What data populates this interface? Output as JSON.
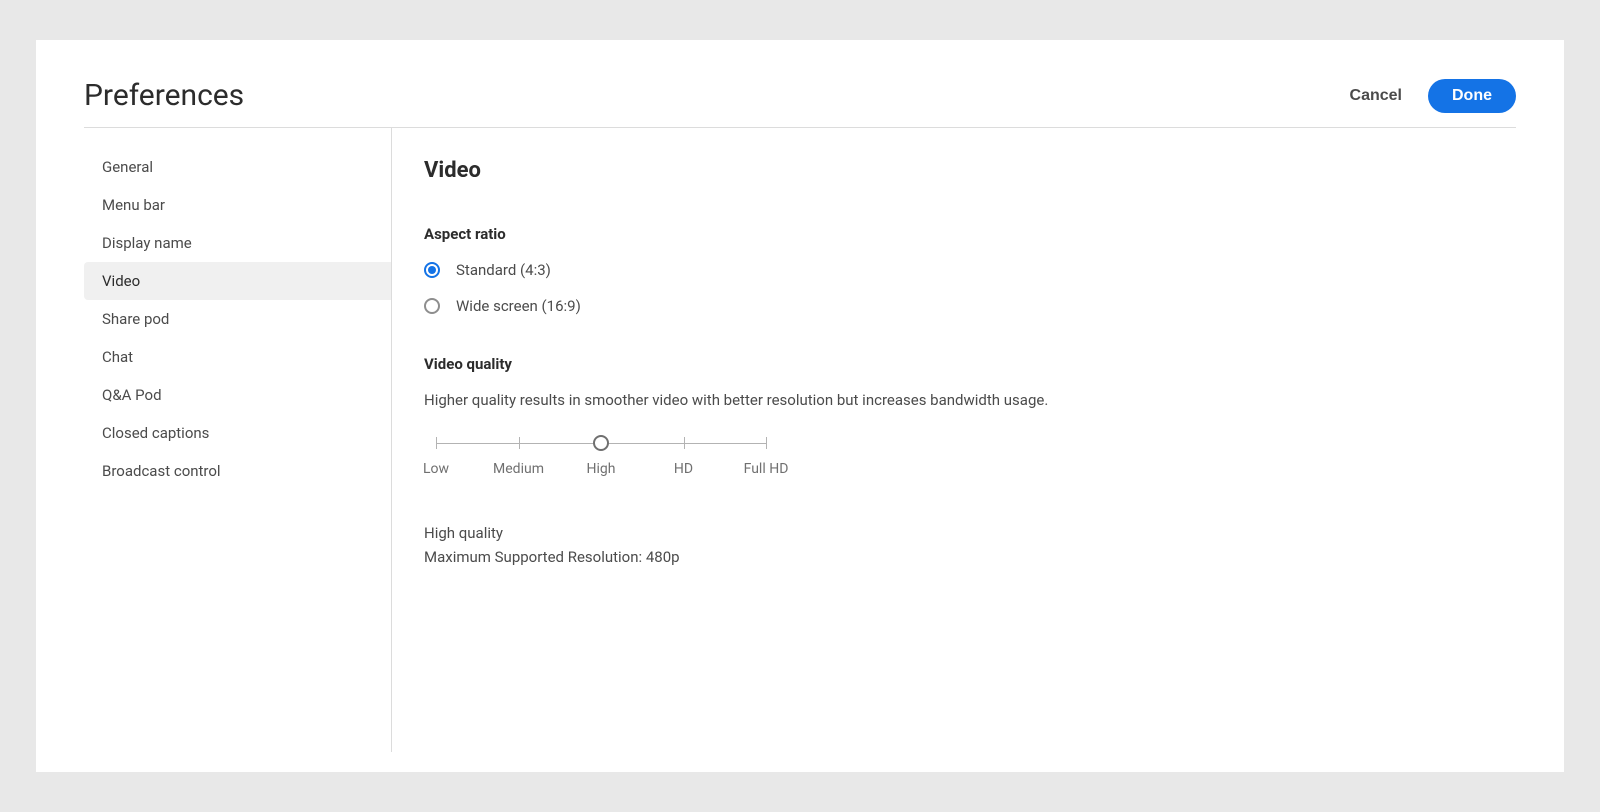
{
  "header": {
    "title": "Preferences",
    "cancel_label": "Cancel",
    "done_label": "Done"
  },
  "sidebar": {
    "items": [
      {
        "label": "General"
      },
      {
        "label": "Menu bar"
      },
      {
        "label": "Display name"
      },
      {
        "label": "Video"
      },
      {
        "label": "Share pod"
      },
      {
        "label": "Chat"
      },
      {
        "label": "Q&A Pod"
      },
      {
        "label": "Closed captions"
      },
      {
        "label": "Broadcast control"
      }
    ],
    "active_index": 3
  },
  "content": {
    "title": "Video",
    "aspect_ratio": {
      "label": "Aspect ratio",
      "options": [
        {
          "label": "Standard (4:3)"
        },
        {
          "label": "Wide screen (16:9)"
        }
      ],
      "selected_index": 0
    },
    "video_quality": {
      "label": "Video quality",
      "description": "Higher quality results in smoother video with better resolution but increases bandwidth usage.",
      "ticks": [
        "Low",
        "Medium",
        "High",
        "HD",
        "Full HD"
      ],
      "selected_index": 2,
      "readout_line1": "High quality",
      "readout_line2": "Maximum Supported Resolution: 480p"
    }
  }
}
